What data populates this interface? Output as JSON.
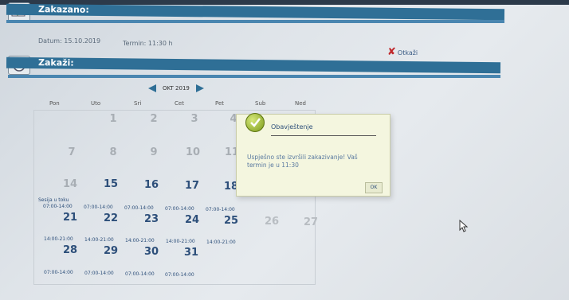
{
  "sections": {
    "booked_title": "Zakazano:",
    "book_title": "Zakaži:"
  },
  "booking": {
    "date": "Datum: 15.10.2019",
    "time": "Termin: 11:30 h",
    "cancel_label": "Otkaži"
  },
  "calendar": {
    "month": "OKT 2019",
    "weekdays": [
      "Pon",
      "Uto",
      "Sri",
      "Cet",
      "Pet",
      "Sub",
      "Ned"
    ],
    "week1": [
      "1",
      "2",
      "3",
      "4"
    ],
    "week2": [
      "7",
      "8",
      "9",
      "10",
      "11"
    ],
    "week3": [
      "14",
      "15",
      "16",
      "17",
      "18"
    ],
    "session_note": "Sesija u toku",
    "week4": [
      "21",
      "22",
      "23",
      "24",
      "25",
      "26",
      "27"
    ],
    "week4_slots": [
      "07:00-14:00",
      "07:00-14:00",
      "07:00-14:00",
      "07:00-14:00",
      "07:00-14:00"
    ],
    "week5_slots_top": [
      "14:00-21:00",
      "14:00-21:00",
      "14:00-21:00",
      "14:00-21:00",
      "14:00-21:00"
    ],
    "week5": [
      "28",
      "29",
      "30",
      "31"
    ],
    "week5_slots": [
      "07:00-14:00",
      "07:00-14:00",
      "07:00-14:00",
      "07:00-14:00"
    ]
  },
  "dialog": {
    "title": "Obavještenje",
    "message": "Uspješno ste izvršili zakazivanje! Vaš termin je u 11:30",
    "ok_label": "OK"
  },
  "colors": {
    "section_bar": "#2f6f96",
    "day_active": "#2d4f7a",
    "cancel_icon": "#c0282b"
  }
}
